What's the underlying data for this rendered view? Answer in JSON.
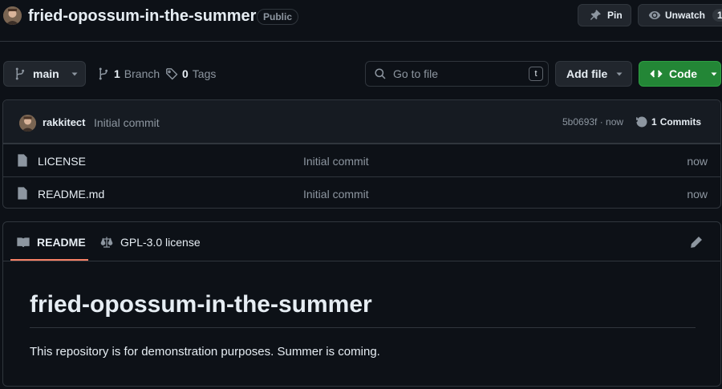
{
  "header": {
    "repo_name": "fried-opossum-in-the-summer",
    "visibility_badge": "Public",
    "pin_label": "Pin",
    "watch_label": "Unwatch",
    "watch_count": "1"
  },
  "toolbar": {
    "branch_name": "main",
    "branches_count": "1",
    "branches_label": "Branch",
    "tags_count": "0",
    "tags_label": "Tags",
    "search_placeholder": "Go to file",
    "search_shortcut": "t",
    "add_file_label": "Add file",
    "code_label": "Code"
  },
  "commit": {
    "author": "rakkitect",
    "message": "Initial commit",
    "meta": "5b0693f · now",
    "commits_count": "1",
    "commits_label": "Commits"
  },
  "files": [
    {
      "name": "LICENSE",
      "commit": "Initial commit",
      "age": "now"
    },
    {
      "name": "README.md",
      "commit": "Initial commit",
      "age": "now"
    }
  ],
  "readme": {
    "tab_readme": "README",
    "tab_license": "GPL-3.0 license",
    "title": "fried-opossum-in-the-summer",
    "body": "This repository is for demonstration purposes. Summer is coming."
  },
  "colors": {
    "background": "#0d1117",
    "border": "#30363d",
    "code_button": "#238636",
    "tab_accent": "#f78166"
  },
  "icons": [
    "avatar",
    "pin-icon",
    "eye-icon",
    "branch-icon",
    "chevron-down-icon",
    "tag-icon",
    "search-icon",
    "code-icon",
    "history-icon",
    "file-icon",
    "book-icon",
    "law-icon",
    "pencil-icon"
  ]
}
